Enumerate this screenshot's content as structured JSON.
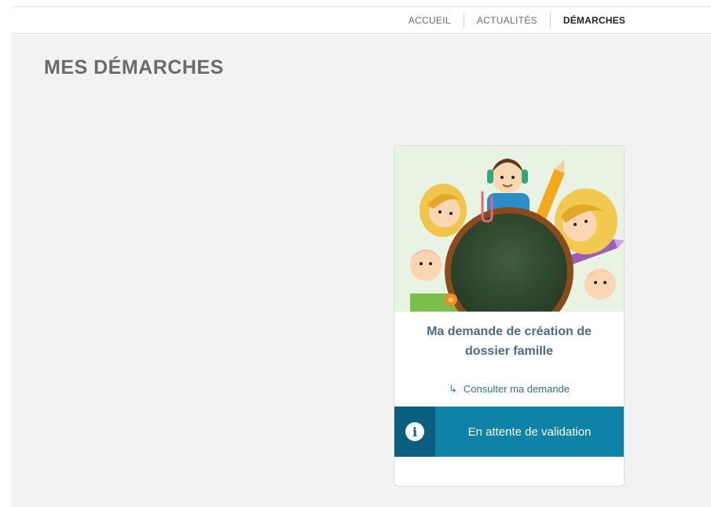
{
  "nav": {
    "items": [
      {
        "label": "ACCUEIL"
      },
      {
        "label": "ACTUALITÉS"
      },
      {
        "label": "DÉMARCHES"
      }
    ]
  },
  "page": {
    "title": "MES DÉMARCHES"
  },
  "card": {
    "title": "Ma demande de création de dossier famille",
    "link_label": "Consulter ma demande",
    "status_label": "En attente de validation",
    "illustration_icon": "children-around-chalkboard-illustration"
  },
  "colors": {
    "page_bg": "#f2f2f2",
    "status_bar": "#0f82a8",
    "status_icon_box": "#0a5f80",
    "card_title": "#4d6a84"
  }
}
